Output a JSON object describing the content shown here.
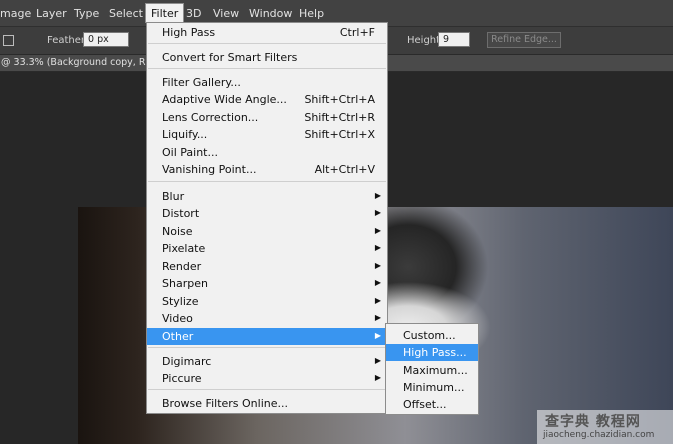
{
  "menubar": {
    "items": [
      "mage",
      "Layer",
      "Type",
      "Select",
      "Filter",
      "3D",
      "View",
      "Window",
      "Help"
    ]
  },
  "options": {
    "feather_label": "Feather:",
    "feather_value": "0 px",
    "height_label": "Height:",
    "height_value": "9",
    "refine_edge": "Refine Edge..."
  },
  "document": {
    "tab_title": "@ 33.3% (Background copy, RGB/"
  },
  "filter_menu": {
    "items": [
      {
        "label": "High Pass",
        "shortcut": "Ctrl+F"
      },
      {
        "label": "Convert for Smart Filters"
      },
      {
        "label": "Filter Gallery..."
      },
      {
        "label": "Adaptive Wide Angle...",
        "shortcut": "Shift+Ctrl+A"
      },
      {
        "label": "Lens Correction...",
        "shortcut": "Shift+Ctrl+R"
      },
      {
        "label": "Liquify...",
        "shortcut": "Shift+Ctrl+X"
      },
      {
        "label": "Oil Paint..."
      },
      {
        "label": "Vanishing Point...",
        "shortcut": "Alt+Ctrl+V"
      },
      {
        "label": "Blur"
      },
      {
        "label": "Distort"
      },
      {
        "label": "Noise"
      },
      {
        "label": "Pixelate"
      },
      {
        "label": "Render"
      },
      {
        "label": "Sharpen"
      },
      {
        "label": "Stylize"
      },
      {
        "label": "Video"
      },
      {
        "label": "Other"
      },
      {
        "label": "Digimarc"
      },
      {
        "label": "Piccure"
      },
      {
        "label": "Browse Filters Online..."
      }
    ]
  },
  "other_submenu": {
    "items": [
      "Custom...",
      "High Pass...",
      "Maximum...",
      "Minimum...",
      "Offset..."
    ]
  },
  "watermark": {
    "cn": "查字典 教程网",
    "url": "jiaocheng.chazidian.com"
  },
  "colors": {
    "highlight": "#3995f0",
    "menu_bg": "#f1f1f1",
    "menubar_bg": "#424242"
  }
}
